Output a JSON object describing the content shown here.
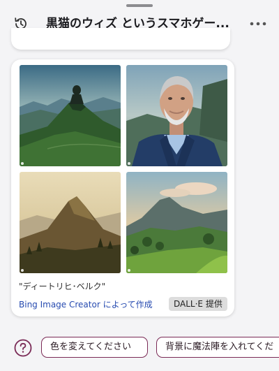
{
  "header": {
    "title": "黒猫のウィズ というスマホゲー..."
  },
  "image_card": {
    "images": [
      {
        "alt": "mountain peak with figure"
      },
      {
        "alt": "portrait of older man with beard"
      },
      {
        "alt": "mountain peak at sunset"
      },
      {
        "alt": "green hills with mountain"
      }
    ],
    "caption": "\"ディートリヒ･ベルク\"",
    "credit_link": "Bing Image Creator によって作成",
    "provider_badge": "DALL·E 提供"
  },
  "suggestions": [
    "色を変えてください",
    "背景に魔法陣を入れてくだ"
  ],
  "colors": {
    "accent": "#7a2a56",
    "link": "#274bb0",
    "background": "#f4f4f6"
  }
}
